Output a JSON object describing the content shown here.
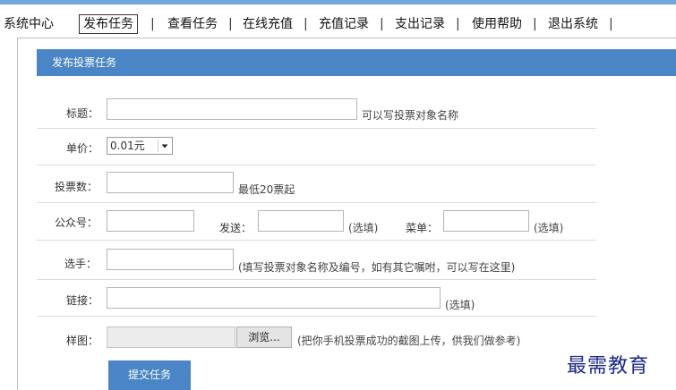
{
  "nav": {
    "items": [
      {
        "label": "系统中心",
        "active": false
      },
      {
        "label": "发布任务",
        "active": true
      },
      {
        "label": "查看任务",
        "active": false
      },
      {
        "label": "在线充值",
        "active": false
      },
      {
        "label": "充值记录",
        "active": false
      },
      {
        "label": "支出记录",
        "active": false
      },
      {
        "label": "使用帮助",
        "active": false
      },
      {
        "label": "退出系统",
        "active": false
      }
    ],
    "separator": "|"
  },
  "panel": {
    "title": "发布投票任务"
  },
  "form": {
    "title_label": "标题：",
    "title_hint": "可以写投票对象名称",
    "price_label": "单价：",
    "price_value": "0.01元",
    "votes_label": "投票数：",
    "votes_hint": "最低20票起",
    "account_label": "公众号：",
    "send_label": "发送：",
    "send_hint": "(选填)",
    "menu_label": "菜单：",
    "menu_hint": "(选填)",
    "player_label": "选手：",
    "player_hint": "(填写投票对象名称及编号，如有其它嘱咐，可以写在这里)",
    "link_label": "链接：",
    "link_hint": "(选填)",
    "sample_label": "样图：",
    "browse_label": "浏览...",
    "sample_hint": "(把你手机投票成功的截图上传，供我们做参考)",
    "submit_label": "提交任务"
  },
  "watermark": "最需教育",
  "colors": {
    "accent": "#4a86c5",
    "top_strip": "#6fa8dc",
    "watermark": "#1a2a8a"
  }
}
